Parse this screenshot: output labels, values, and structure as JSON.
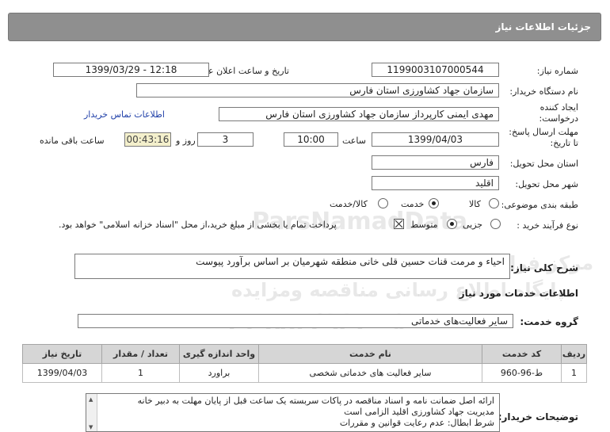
{
  "header": {
    "title": "جزئیات اطلاعات نیاز"
  },
  "fields": {
    "need_number_label": "شماره نیاز:",
    "need_number": "1199003107000544",
    "announce_label": "تاریخ و ساعت اعلان عمومی:",
    "announce_value": "1399/03/29 - 12:18",
    "buyer_org_label": "نام دستگاه خریدار:",
    "buyer_org": "سازمان جهاد کشاورزی استان فارس",
    "creator_label_1": "ایجاد کننده",
    "creator_label_2": "درخواست:",
    "creator": "مهدی ایمنی کارپرداز سازمان جهاد کشاورزی استان فارس",
    "contact_link": "اطلاعات تماس خریدار",
    "deadline_label_1": "مهلت ارسال پاسخ:",
    "deadline_label_2": "تا تاریخ:",
    "deadline_date": "1399/04/03",
    "time_label": "ساعت",
    "deadline_time": "10:00",
    "days": "3",
    "days_label": "روز و",
    "remaining": "00:43:16",
    "remaining_label": "ساعت باقی مانده",
    "province_label": "استان محل تحویل:",
    "province": "فارس",
    "city_label": "شهر محل تحویل:",
    "city": "اقلید",
    "category_label": "طبقه بندی موضوعی:",
    "category_options": [
      "کالا",
      "خدمت",
      "کالا/خدمت"
    ],
    "category_selected": "خدمت",
    "process_label": "نوع فرآیند خرید :",
    "process_options": [
      "جزیی",
      "متوسط"
    ],
    "process_selected": "متوسط",
    "payment_note": "پرداخت تمام یا بخشی از مبلغ خرید،از محل \"اسناد خزانه اسلامی\" خواهد بود.",
    "payment_checked": true
  },
  "description": {
    "label": "شرح کلی نیاز:",
    "text": "احیاء و مرمت قنات حسین قلی خانی منطقه شهرمیان بر اساس برآورد پیوست"
  },
  "services": {
    "section_title": "اطلاعات خدمات مورد نیاز",
    "group_label": "گروه خدمت:",
    "group_value": "سایر فعالیت‌های خدماتی",
    "columns": [
      "ردیف",
      "کد خدمت",
      "نام خدمت",
      "واحد اندازه گیری",
      "تعداد / مقدار",
      "تاریخ نیاز"
    ],
    "rows": [
      [
        "1",
        "ط-96-960",
        "سایر فعالیت های خدماتی شخصی",
        "براورد",
        "1",
        "1399/04/03"
      ]
    ]
  },
  "buyer_notes": {
    "label": "توضیحات خریدار:",
    "lines": [
      "ارائه اصل ضمانت نامه و اسناد مناقصه  در پاکات سربسته یک ساعت قبل از پایان مهلت به دبیر خانه",
      "مدیریت جهاد کشاورزی اقلید الزامی است",
      "شرط ابطال: عدم رعایت قوانین و مقررات"
    ]
  },
  "watermark": {
    "brand": "ParsNamadData",
    "line1": "مرکز فراوری اطلاعات پارس نماد داده ها",
    "line2": "پایگاه اطلاع رسانی مناقصه ومزایده",
    "phone": "۰۲۱-۸۸۳۴۹۶۷۰-۵"
  }
}
